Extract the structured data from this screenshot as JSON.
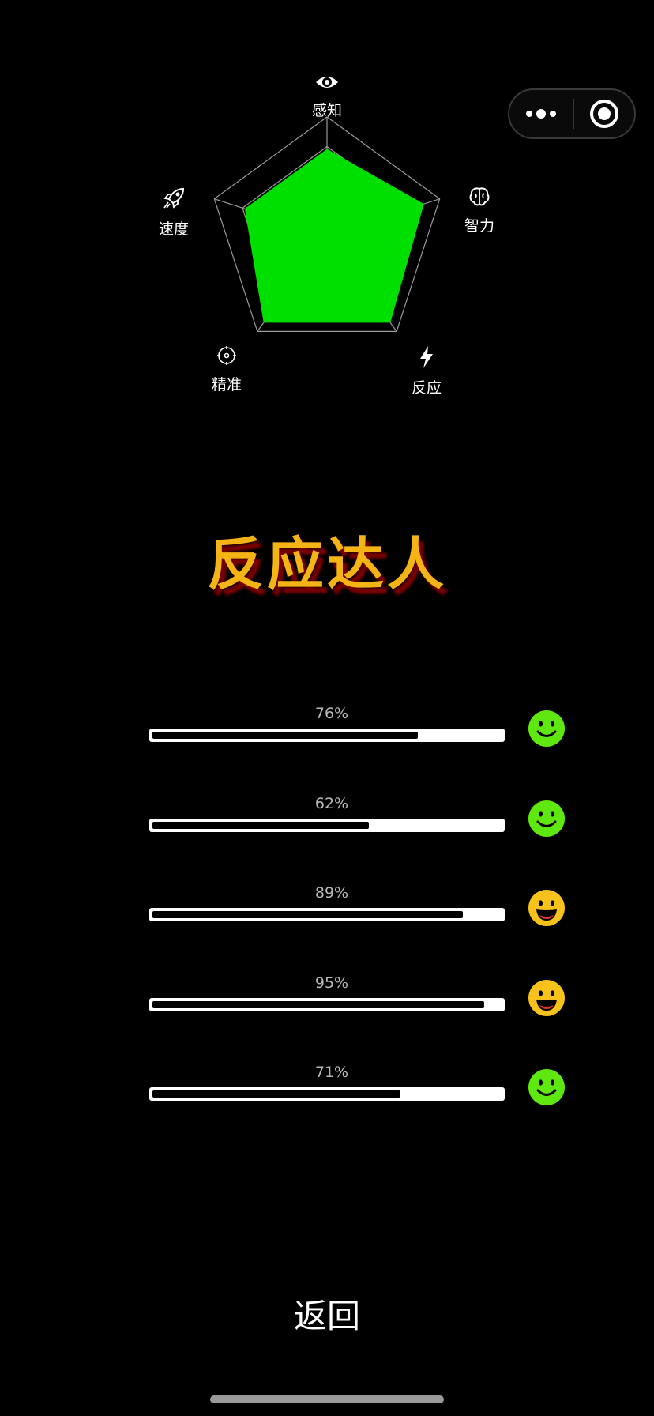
{
  "capsule": {
    "more_icon": "more-dots-icon",
    "close_icon": "target-circle-icon"
  },
  "radar": {
    "axes": [
      {
        "label": "感知",
        "icon": "eye-icon",
        "value": 0.73
      },
      {
        "label": "智力",
        "icon": "brain-icon",
        "value": 0.86
      },
      {
        "label": "反应",
        "icon": "lightning-icon",
        "value": 0.91
      },
      {
        "label": "精准",
        "icon": "target-icon",
        "value": 0.91
      },
      {
        "label": "速度",
        "icon": "rocket-icon",
        "value": 0.73
      }
    ],
    "fill_color": "#00e000",
    "grid_color": "#9a9a9a",
    "grid_levels": 4
  },
  "result_title": "反应达人",
  "scores": [
    {
      "percent_text": "76%",
      "value": 0.76,
      "face": "smile",
      "face_color": "#5ee810"
    },
    {
      "percent_text": "62%",
      "value": 0.62,
      "face": "smile",
      "face_color": "#5ee810"
    },
    {
      "percent_text": "89%",
      "value": 0.89,
      "face": "grin",
      "face_color": "#f7c21b"
    },
    {
      "percent_text": "95%",
      "value": 0.95,
      "face": "grin",
      "face_color": "#f7c21b"
    },
    {
      "percent_text": "71%",
      "value": 0.71,
      "face": "smile",
      "face_color": "#5ee810"
    }
  ],
  "back_label": "返回"
}
